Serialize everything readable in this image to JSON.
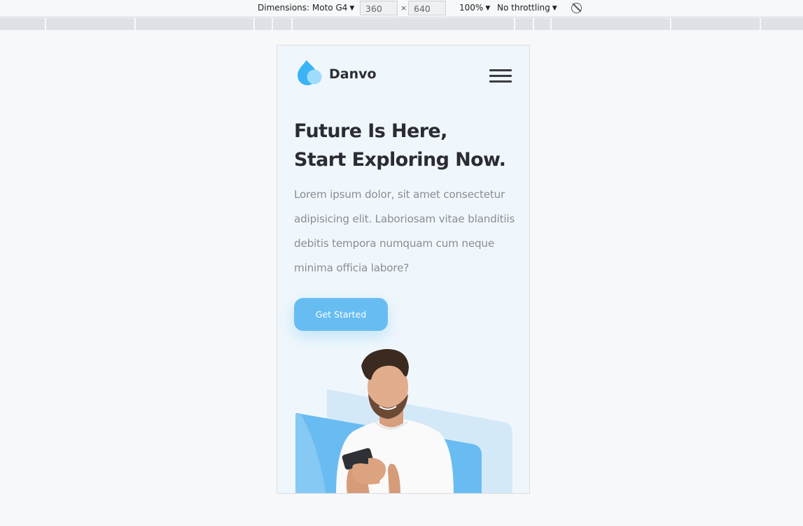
{
  "devtools": {
    "dimensions_label": "Dimensions: Moto G4",
    "width_value": "360",
    "times": "×",
    "height_value": "640",
    "zoom": "100%",
    "throttling": "No throttling"
  },
  "site": {
    "brand": "Danvo",
    "colors": {
      "accent": "#67bdf2",
      "heading": "#2b2b33",
      "body_text": "#8b8b94",
      "background": "#f0f7fc"
    },
    "hero": {
      "headline_line1": "Future Is Here,",
      "headline_line2": "Start Exploring Now.",
      "lead": "Lorem ipsum dolor, sit amet consectetur adipisicing elit. Laboriosam vitae blanditiis debitis tempora numquam cum neque minima officia labore?",
      "cta_label": "Get Started"
    },
    "icons": {
      "logo": "water-drop-logo-icon",
      "menu": "hamburger-menu-icon"
    }
  }
}
